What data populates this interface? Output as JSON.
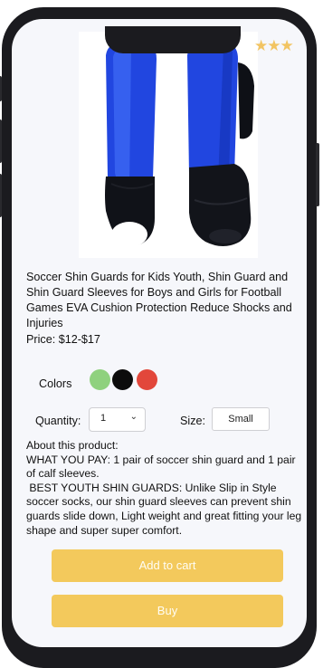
{
  "product": {
    "rating_stars": "★★★",
    "title": "Soccer Shin Guards for Kids Youth, Shin Guard and Shin Guard Sleeves for Boys and Girls for Football Games EVA Cushion Protection Reduce Shocks and Injuries",
    "price": "Price: $12-$17",
    "image_icon": "shin-guards-photo"
  },
  "options": {
    "colors_label": "Colors",
    "colors": [
      "#8fd17e",
      "#0c0c0c",
      "#e2473b"
    ],
    "quantity_label": "Quantity:",
    "quantity_value": "1",
    "size_label": "Size:",
    "size_value": "Small"
  },
  "about": {
    "heading": "About this product:",
    "line1": "WHAT YOU PAY: 1 pair of soccer shin guard and 1 pair of calf sleeves.",
    "line2": " BEST YOUTH SHIN GUARDS: Unlike Slip in Style soccer socks, our shin guard sleeves can prevent shin guards slide down, Light weight and great fitting your leg shape and super super comfort."
  },
  "actions": {
    "add_to_cart": "Add to cart",
    "buy": "Buy"
  }
}
